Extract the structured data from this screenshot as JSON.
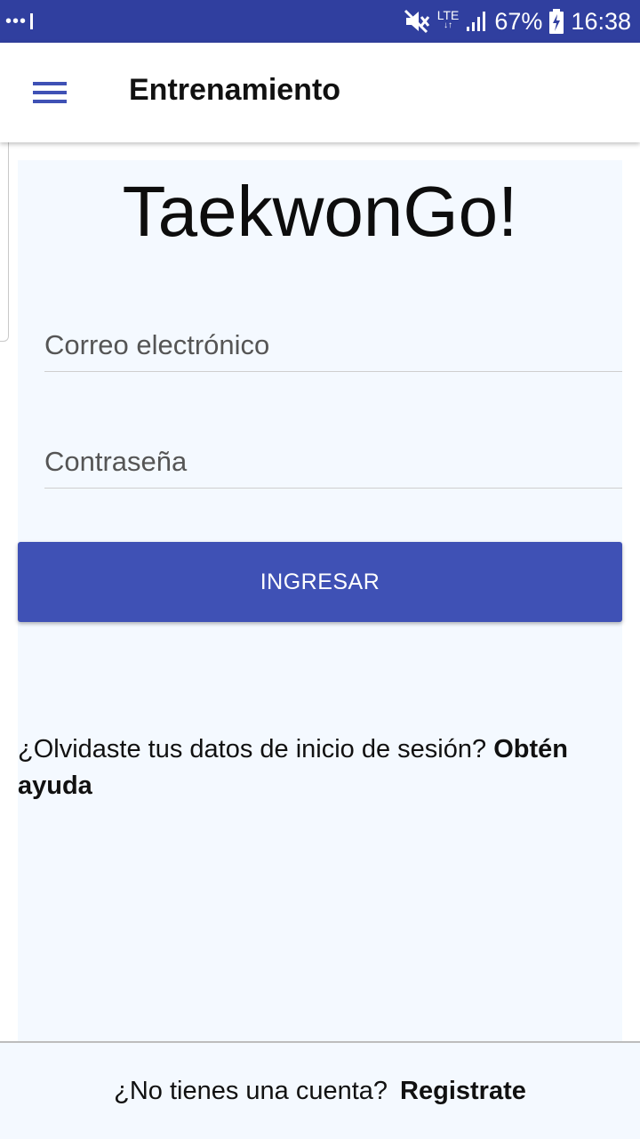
{
  "status_bar": {
    "notification_dots": "•••",
    "network_type": "LTE",
    "battery_percent": "67%",
    "time": "16:38",
    "icons": [
      "more-dots-icon",
      "mute-icon",
      "lte-data-icon",
      "signal-icon",
      "battery-charging-icon"
    ]
  },
  "app_bar": {
    "title": "Entrenamiento",
    "menu_icon": "hamburger-menu-icon"
  },
  "login": {
    "brand": "TaekwonGo!",
    "email_placeholder": "Correo electrónico",
    "email_value": "",
    "password_placeholder": "Contraseña",
    "password_value": "",
    "submit_label": "INGRESAR",
    "forgot_text": "¿Olvidaste tus datos de inicio de sesión?",
    "forgot_link": "Obtén ayuda"
  },
  "footer": {
    "prompt": "¿No tienes una cuenta?",
    "register_link": "Registrate"
  },
  "colors": {
    "status_bar": "#303f9f",
    "primary": "#3f51b5",
    "content_background": "#f4f9ff",
    "text": "#111111"
  }
}
